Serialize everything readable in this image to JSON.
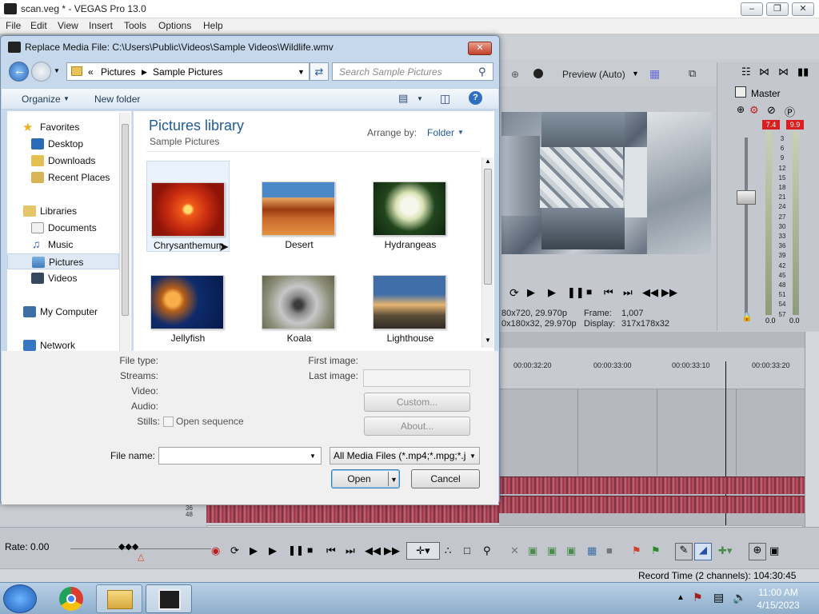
{
  "vegas": {
    "title": "scan.veg * - VEGAS Pro 13.0",
    "menu": [
      "File",
      "Edit",
      "View",
      "Insert",
      "Tools",
      "Options",
      "Help"
    ],
    "preview_mode": "Preview (Auto)",
    "preview_info": {
      "line1_left": "80x720, 29.970p",
      "line2_left": "0x180x32, 29.970p",
      "frame_label": "Frame:",
      "frame_value": "1,007",
      "display_label": "Display:",
      "display_value": "317x178x32"
    },
    "master": {
      "label": "Master",
      "peak_left": "7.4",
      "peak_right": "9.9",
      "scale": [
        "3",
        "6",
        "9",
        "12",
        "15",
        "18",
        "21",
        "24",
        "27",
        "30",
        "33",
        "36",
        "39",
        "42",
        "45",
        "48",
        "51",
        "54",
        "57"
      ],
      "bottom_left": "0.0",
      "bottom_right": "0.0"
    },
    "timeline_ticks": [
      "00:00:32:20",
      "00:00:33:00",
      "00:00:33:10",
      "00:00:33:20"
    ],
    "track_scale": [
      "36",
      "48"
    ],
    "rate_label": "Rate: 0.00",
    "record_time": "Record Time (2 channels): 104:30:45",
    "colors": {
      "waveform": "#8c3646",
      "peak": "#d91f1f"
    }
  },
  "dialog": {
    "title": "Replace Media File: C:\\Users\\Public\\Videos\\Sample Videos\\Wildlife.wmv",
    "breadcrumb": [
      "Pictures",
      "Sample Pictures"
    ],
    "breadcrumb_prefix": "«",
    "search_placeholder": "Search Sample Pictures",
    "organize": "Organize",
    "new_folder": "New folder",
    "nav": {
      "favorites": "Favorites",
      "desktop": "Desktop",
      "downloads": "Downloads",
      "recent": "Recent Places",
      "libraries": "Libraries",
      "documents": "Documents",
      "music": "Music",
      "pictures": "Pictures",
      "videos": "Videos",
      "computer": "My Computer",
      "network": "Network"
    },
    "library_title": "Pictures library",
    "library_sub": "Sample Pictures",
    "arrange_label": "Arrange by:",
    "arrange_value": "Folder",
    "files": [
      {
        "name": "Chrysanthemum",
        "icon": "flower-thumbnail"
      },
      {
        "name": "Desert",
        "icon": "desert-thumbnail"
      },
      {
        "name": "Hydrangeas",
        "icon": "hydrangea-thumbnail"
      },
      {
        "name": "Jellyfish",
        "icon": "jellyfish-thumbnail"
      },
      {
        "name": "Koala",
        "icon": "koala-thumbnail"
      },
      {
        "name": "Lighthouse",
        "icon": "lighthouse-thumbnail"
      }
    ],
    "labels": {
      "file_type": "File type:",
      "streams": "Streams:",
      "video": "Video:",
      "audio": "Audio:",
      "stills": "Stills:",
      "open_sequence": "Open sequence",
      "first_image": "First image:",
      "last_image": "Last image:",
      "file_name": "File name:"
    },
    "custom_btn": "Custom...",
    "about_btn": "About...",
    "filter": "All Media Files (*.mp4;*.mpg;*.j",
    "open_btn": "Open",
    "cancel_btn": "Cancel"
  },
  "taskbar": {
    "time": "11:00 AM",
    "date": "4/15/2023"
  }
}
